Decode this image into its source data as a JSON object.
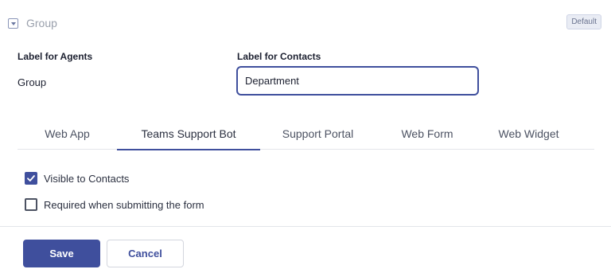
{
  "header": {
    "title": "Group",
    "badge": "Default"
  },
  "fields": {
    "agents": {
      "label": "Label for Agents",
      "value": "Group"
    },
    "contacts": {
      "label": "Label for Contacts",
      "value": "Department"
    }
  },
  "tabs": [
    {
      "label": "Web App",
      "active": false
    },
    {
      "label": "Teams Support Bot",
      "active": true
    },
    {
      "label": "Support Portal",
      "active": false
    },
    {
      "label": "Web Form",
      "active": false
    },
    {
      "label": "Web Widget",
      "active": false
    }
  ],
  "options": {
    "visible": {
      "label": "Visible to Contacts",
      "checked": true
    },
    "required": {
      "label": "Required when submitting the form",
      "checked": false
    }
  },
  "actions": {
    "save_label": "Save",
    "cancel_label": "Cancel"
  },
  "colors": {
    "accent": "#3f4f9d",
    "muted_text": "#9aa0ac",
    "divider": "#e3e5ea"
  },
  "icons": {
    "header": "dropdown-field-icon",
    "checkmark": "checkmark-icon"
  }
}
